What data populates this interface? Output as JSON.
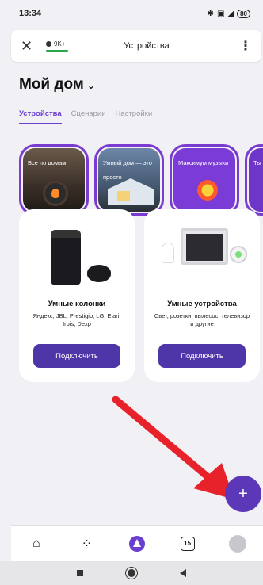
{
  "status_bar": {
    "time": "13:34",
    "icons": [
      "bluetooth-icon",
      "sim-icon",
      "signal-icon",
      "battery-icon"
    ],
    "battery": "80"
  },
  "browser_bar": {
    "close_icon": "close-icon",
    "site_label": "9K+",
    "title": "Устройства",
    "menu_icon": "kebab-menu-icon"
  },
  "home": {
    "title": "Мой дом"
  },
  "tabs": [
    {
      "label": "Устройства",
      "active": true
    },
    {
      "label": "Сценарии",
      "active": false
    },
    {
      "label": "Настройки",
      "active": false
    }
  ],
  "stories": [
    {
      "label": "Все по домам"
    },
    {
      "label": "Умный дом — это просто"
    },
    {
      "label": "Максимум музыки"
    },
    {
      "label": "Ты на"
    }
  ],
  "cards": [
    {
      "title": "Умные колонки",
      "subtitle": "Яндекс, JBL, Prestigio, LG, Elari, Irbis, Dexp",
      "button": "Подключить"
    },
    {
      "title": "Умные устройства",
      "subtitle": "Свет, розетки, пылесос, телевизор и другие",
      "button": "Подключить"
    }
  ],
  "fab": {
    "label": "+"
  },
  "bottom_nav": {
    "items": [
      "home-icon",
      "apps-grid-icon",
      "alice-icon",
      "calendar-icon",
      "profile-avatar"
    ],
    "calendar_day": "15"
  },
  "colors": {
    "accent": "#6a3fd0",
    "button": "#4e35a8",
    "annotation_arrow": "#e8222a"
  }
}
